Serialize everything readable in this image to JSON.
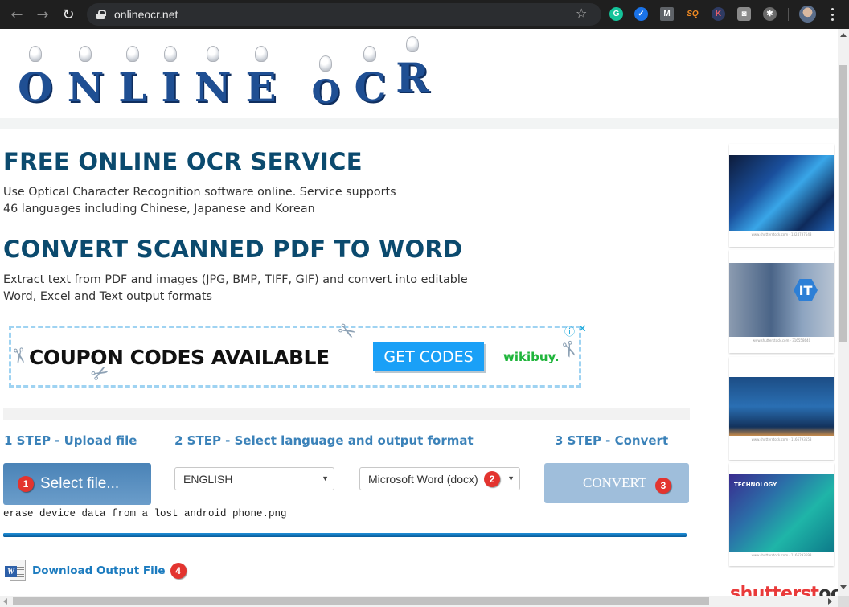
{
  "browser": {
    "url": "onlineocr.net",
    "extensions": [
      {
        "name": "grammarly-icon",
        "glyph": "G",
        "color": "#15c39a"
      },
      {
        "name": "checkmark-extension-icon",
        "glyph": "✓",
        "color": "#1a73e8"
      },
      {
        "name": "m-extension-icon",
        "glyph": "M",
        "color": "#5f6368"
      },
      {
        "name": "sq-extension-icon",
        "glyph": "SQ",
        "color": "#f28b22"
      },
      {
        "name": "k-extension-icon",
        "glyph": "K",
        "color": "#2f3b63"
      },
      {
        "name": "bag-extension-icon",
        "glyph": "◙",
        "color": "#8a8a8a"
      },
      {
        "name": "shield-extension-icon",
        "glyph": "✱",
        "color": "#6a6a6a"
      }
    ]
  },
  "logo": {
    "letters": [
      "O",
      "N",
      "L",
      "I",
      "N",
      "E",
      " ",
      "O",
      "C",
      "R"
    ]
  },
  "content": {
    "heading1": "FREE ONLINE OCR SERVICE",
    "para1_line1": "Use Optical Character Recognition software online. Service supports",
    "para1_line2": "46 languages including Chinese, Japanese and Korean",
    "heading2": "CONVERT SCANNED PDF TO WORD",
    "para2_line1": "Extract text from PDF and images (JPG, BMP, TIFF, GIF) and convert into editable",
    "para2_line2": "Word, Excel and Text output formats"
  },
  "ad_banner": {
    "text": "COUPON CODES AVAILABLE",
    "button": "GET CODES",
    "brand": "wikibuy.",
    "info_icon": "ⓘ",
    "close_icon": "✕"
  },
  "steps": {
    "step1": "1 STEP - Upload file",
    "step2": "2 STEP - Select language and output format",
    "step3": "3 STEP - Convert",
    "select_file": "Select file...",
    "language": "ENGLISH",
    "output_format": "Microsoft Word (docx)",
    "convert": "CONVERT",
    "filename": "erase device data from a lost android phone.png",
    "progress": 1.0,
    "download": "Download Output File",
    "badges": [
      "1",
      "2",
      "3",
      "4"
    ]
  },
  "sidebar_ads": {
    "captions": [
      "www.shutterstock.com · 1324737548",
      "www.shutterstock.com · 316558640",
      "www.shutterstock.com · 1166793558",
      "www.shutterstock.com · 1166293598"
    ],
    "tech_label": "TECHNOLOGY",
    "it_label": "IT",
    "logo_red": "shutterst",
    "logo_dark": "ock"
  }
}
